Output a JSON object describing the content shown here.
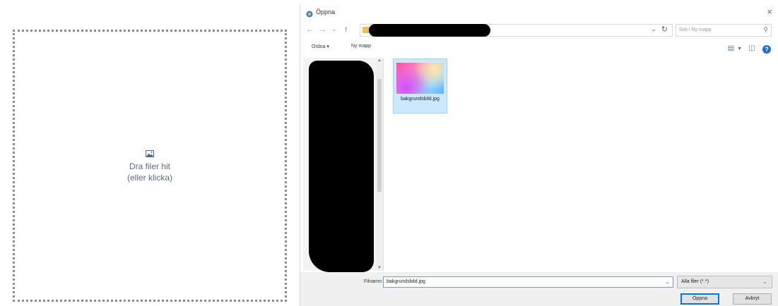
{
  "dropzone": {
    "line1": "Dra filer hit",
    "line2": "(eller klicka)",
    "icon": "image-icon"
  },
  "dialog": {
    "title": "Öppna",
    "close_glyph": "×",
    "nav": {
      "back": "←",
      "forward": "→",
      "recent": "⌄",
      "up": "↑"
    },
    "address": {
      "chevron": "⌄",
      "refresh": "↻"
    },
    "search_placeholder": "Sök i Ny mapp",
    "search_icon_glyph": "⚲",
    "organize_label": "Ordna ▾",
    "new_folder_label": "Ny mapp",
    "view_icons": {
      "change_view": "▤",
      "view_menu": "▾",
      "preview_pane": "◫",
      "help": "?"
    },
    "files": [
      {
        "name": "bakgrundsbild.jpg",
        "selected": true
      }
    ],
    "filename_label": "Filnamn:",
    "filename_value": "bakgrundsbild.jpg",
    "filter_value": "Alla filer (*.*)",
    "open_button": "Öppna",
    "cancel_button": "Avbryt"
  },
  "colors": {
    "selection_bg": "#cce8ff",
    "selection_border": "#99d1ff",
    "help_blue": "#1f6fcf",
    "dropzone_text": "#5a6b80"
  }
}
